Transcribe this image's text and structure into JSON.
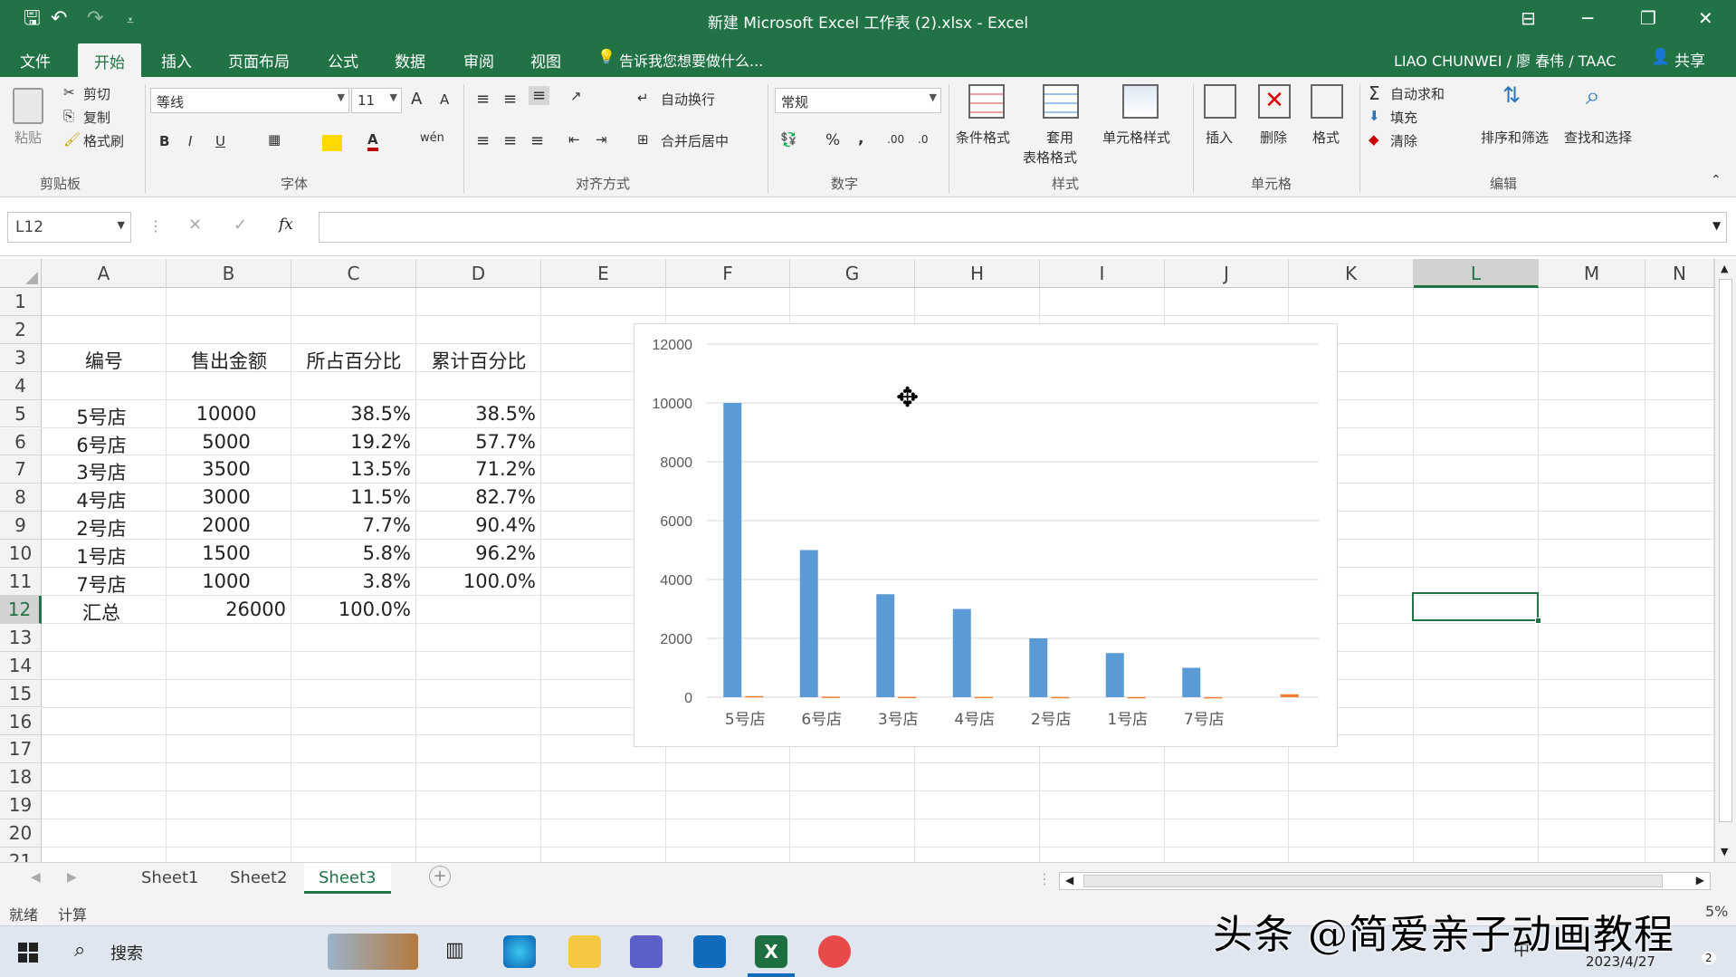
{
  "window": {
    "title": "新建 Microsoft Excel 工作表 (2).xlsx - Excel",
    "controls": {
      "ribbon_options": "⊟",
      "minimize": "─",
      "restore": "❐",
      "close": "✕"
    }
  },
  "quick_access": {
    "save": "🖫",
    "undo": "↶",
    "redo": "↷",
    "customize": "⩡"
  },
  "tabs": [
    {
      "label": "文件"
    },
    {
      "label": "开始"
    },
    {
      "label": "插入"
    },
    {
      "label": "页面布局"
    },
    {
      "label": "公式"
    },
    {
      "label": "数据"
    },
    {
      "label": "审阅"
    },
    {
      "label": "视图"
    }
  ],
  "tell_me": "告诉我您想要做什么...",
  "user": "LIAO CHUNWEI / 廖 春伟 / TAAC",
  "share": "共享",
  "ribbon": {
    "clipboard": {
      "paste": "粘贴",
      "cut": "剪切",
      "copy": "复制",
      "format_painter": "格式刷",
      "label": "剪贴板"
    },
    "font": {
      "name": "等线",
      "size": "11",
      "label": "字体",
      "bold": "B",
      "italic": "I",
      "underline": "U",
      "grow": "A",
      "shrink": "A",
      "phonetic": "wén"
    },
    "alignment": {
      "wrap": "自动换行",
      "merge": "合并后居中",
      "label": "对齐方式"
    },
    "number": {
      "format": "常规",
      "percent": "%",
      "comma": ",",
      "inc_dec": ".00",
      "dec_dec": ".0",
      "label": "数字"
    },
    "styles": {
      "conditional": "条件格式",
      "table": "套用",
      "table2": "表格格式",
      "cell_styles": "单元格样式",
      "label": "样式"
    },
    "cells": {
      "insert": "插入",
      "delete": "删除",
      "format": "格式",
      "label": "单元格"
    },
    "editing": {
      "autosum": "自动求和",
      "fill": "填充",
      "clear": "清除",
      "sort": "排序和筛选",
      "find": "查找和选择",
      "label": "编辑"
    }
  },
  "formula_bar": {
    "name_box": "L12",
    "cancel": "✕",
    "enter": "✓",
    "fx": "fx",
    "value": ""
  },
  "columns": [
    "A",
    "B",
    "C",
    "D",
    "E",
    "F",
    "G",
    "H",
    "I",
    "J",
    "K",
    "L",
    "M",
    "N"
  ],
  "rows": [
    "1",
    "2",
    "3",
    "4",
    "5",
    "6",
    "7",
    "8",
    "9",
    "10",
    "11",
    "12",
    "13",
    "14",
    "15",
    "16",
    "17",
    "18",
    "19",
    "20",
    "21"
  ],
  "selected_cell": "L12",
  "table": {
    "headers": [
      "编号",
      "售出金额",
      "所占百分比",
      "累计百分比"
    ],
    "rows": [
      [
        "5号店",
        "10000",
        "38.5%",
        "38.5%"
      ],
      [
        "6号店",
        "5000",
        "19.2%",
        "57.7%"
      ],
      [
        "3号店",
        "3500",
        "13.5%",
        "71.2%"
      ],
      [
        "4号店",
        "3000",
        "11.5%",
        "82.7%"
      ],
      [
        "2号店",
        "2000",
        "7.7%",
        "90.4%"
      ],
      [
        "1号店",
        "1500",
        "5.8%",
        "96.2%"
      ],
      [
        "7号店",
        "1000",
        "3.8%",
        "100.0%"
      ]
    ],
    "total": [
      "汇总",
      "26000",
      "100.0%"
    ]
  },
  "chart_data": {
    "type": "bar",
    "categories": [
      "5号店",
      "6号店",
      "3号店",
      "4号店",
      "2号店",
      "1号店",
      "7号店",
      ""
    ],
    "series": [
      {
        "values": [
          10000,
          5000,
          3500,
          3000,
          2000,
          1500,
          1000,
          null
        ],
        "color": "#5b9bd5"
      },
      {
        "values": [
          38.5,
          19.2,
          13.5,
          11.5,
          7.7,
          5.8,
          3.8,
          100
        ],
        "color": "#ed7d31"
      }
    ],
    "ylim": [
      0,
      12000
    ],
    "yticks": [
      "0",
      "2000",
      "4000",
      "6000",
      "8000",
      "10000",
      "12000"
    ],
    "grid": true,
    "title": "",
    "xlabel": "",
    "ylabel": ""
  },
  "sheets": [
    {
      "label": "Sheet1"
    },
    {
      "label": "Sheet2"
    },
    {
      "label": "Sheet3"
    }
  ],
  "active_sheet": "Sheet3",
  "status": {
    "ready": "就绪",
    "calc": "计算",
    "zoom": "5%"
  },
  "taskbar": {
    "search": "搜索",
    "date": "2023/4/27",
    "ime": "中",
    "badge": "2"
  },
  "watermark": "头条 @简爱亲子动画教程",
  "colors": {
    "excel_green": "#217346",
    "bar_blue": "#5b9bd5",
    "bar_orange": "#ed7d31"
  }
}
